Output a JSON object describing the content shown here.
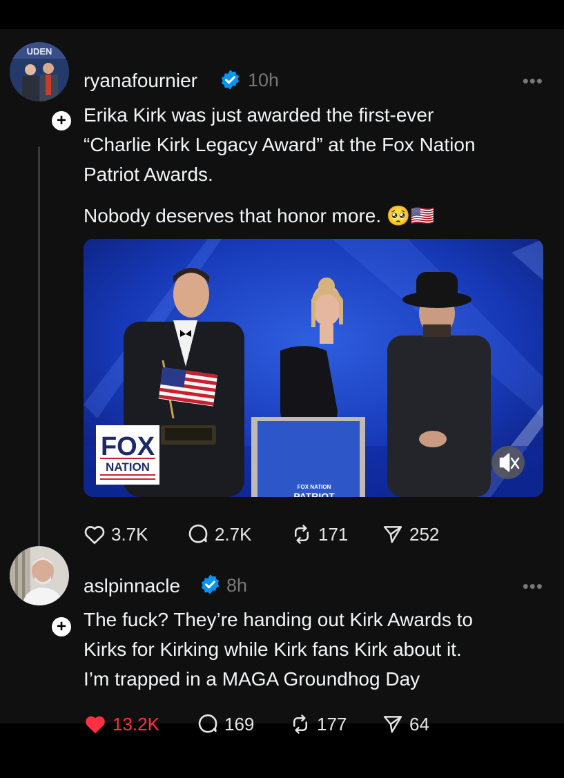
{
  "posts": [
    {
      "username": "ryanafournier",
      "time": "10h",
      "more": "•••",
      "text_lines": [
        "Erika Kirk was just awarded the first-ever",
        "“Charlie Kirk Legacy Award” at the Fox Nation",
        "Patriot Awards."
      ],
      "text2": "Nobody deserves that honor more. 🥺🇺🇸",
      "avatar_banner": "UDEN",
      "media": {
        "logo_line1": "FOX",
        "logo_line2": "NATION",
        "podium_text": "FOX NATION",
        "podium_text2": "PATRIOT"
      },
      "stats": {
        "likes": "3.7K",
        "replies": "2.7K",
        "reposts": "171",
        "shares": "252"
      }
    },
    {
      "username": "aslpinnacle",
      "time": "8h",
      "more": "•••",
      "text_lines": [
        "The fuck? They’re handing out Kirk Awards to",
        "Kirks for Kirking while Kirk fans Kirk about it.",
        "I’m trapped in a MAGA Groundhog Day"
      ],
      "stats": {
        "likes": "13.2K",
        "replies": "169",
        "reposts": "177",
        "shares": "64"
      }
    }
  ],
  "colors": {
    "verified": "#0095f6",
    "like_red": "#ff3040",
    "background": "#101010"
  }
}
